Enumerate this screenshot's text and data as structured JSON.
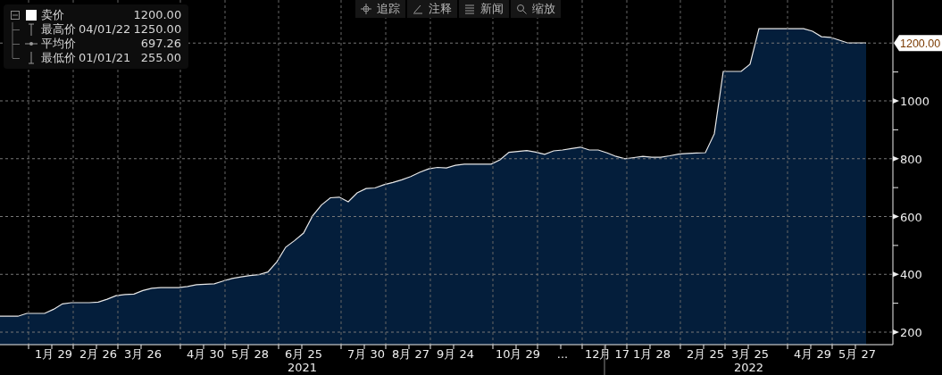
{
  "toolbar": [
    {
      "kind": "track",
      "label": "追踪"
    },
    {
      "kind": "annotate",
      "label": "注释"
    },
    {
      "kind": "news",
      "label": "新闻"
    },
    {
      "kind": "zoom",
      "label": "缩放"
    }
  ],
  "legend": {
    "expanded": true,
    "rows": [
      {
        "kind": "series",
        "value": "1200.00"
      },
      {
        "kind": "high",
        "name": "最高价",
        "date": "04/01/22",
        "value": "1250.00"
      },
      {
        "kind": "average",
        "name": "平均价",
        "value": "697.26"
      },
      {
        "kind": "low",
        "name": "最低价",
        "date": "01/01/21",
        "value": "255.00"
      }
    ]
  },
  "last_price_tag": "1200.00",
  "years": [
    {
      "label": "2021"
    },
    {
      "label": "2022"
    }
  ],
  "chart_data": {
    "type": "area",
    "grid": true,
    "ylim": [
      156.8,
      1349
    ],
    "yticks": [
      200,
      400,
      600,
      800,
      1000
    ],
    "categories": [
      null,
      null,
      null,
      null,
      null,
      null,
      "1月 29",
      null,
      null,
      null,
      null,
      "2月 26",
      null,
      null,
      null,
      null,
      "3月 26",
      null,
      null,
      null,
      null,
      null,
      null,
      "4月 30",
      null,
      null,
      null,
      null,
      "5月 28",
      null,
      null,
      null,
      null,
      null,
      "6月 25",
      null,
      null,
      null,
      null,
      null,
      null,
      "7月 30",
      null,
      null,
      null,
      null,
      "8月 27",
      null,
      null,
      null,
      null,
      "9月 24",
      null,
      null,
      null,
      null,
      null,
      null,
      "10月 29",
      null,
      null,
      null,
      null,
      "...",
      null,
      null,
      null,
      null,
      "12月 17",
      null,
      null,
      null,
      null,
      "1月 28",
      null,
      null,
      null,
      null,
      null,
      "2月 25",
      null,
      null,
      null,
      null,
      "3月 25",
      null,
      null,
      null,
      null,
      null,
      null,
      "4月 29",
      null,
      null,
      null,
      null,
      "5月 27",
      null
    ],
    "series": [
      {
        "name": "卖价",
        "color": "#041e3b",
        "values": [
          255,
          255,
          255,
          265,
          265,
          265,
          279,
          298,
          302,
          302,
          302,
          304,
          314,
          326,
          330,
          332,
          344,
          352,
          354,
          354,
          354,
          358,
          364,
          366,
          367,
          377,
          386,
          391,
          396,
          399,
          408,
          443,
          494,
          517,
          543,
          602,
          640,
          665,
          667,
          651,
          682,
          697,
          699,
          710,
          718,
          727,
          738,
          753,
          765,
          770,
          768,
          777,
          781,
          781,
          781,
          781,
          796,
          822,
          825,
          828,
          823,
          815,
          827,
          830,
          835,
          840,
          830,
          830,
          820,
          808,
          800,
          804,
          808,
          805,
          805,
          810,
          816,
          818,
          820,
          821,
          886,
          1102,
          1102,
          1102,
          1127,
          1250,
          1250,
          1250,
          1250,
          1250,
          1250,
          1241,
          1222,
          1220,
          1210,
          1200,
          1200,
          1200
        ]
      }
    ]
  }
}
